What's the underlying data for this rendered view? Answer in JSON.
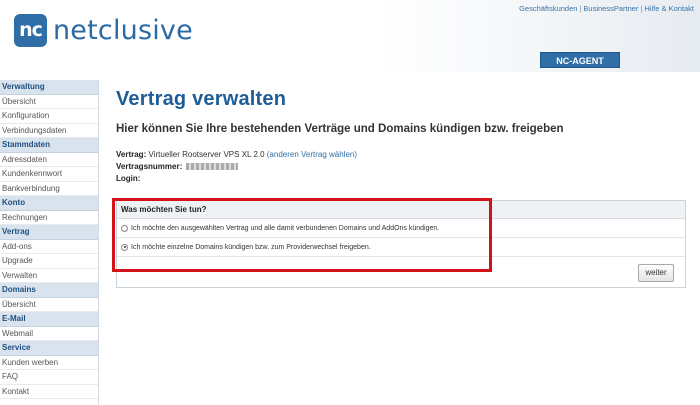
{
  "header": {
    "logo_mark": "nc",
    "logo_text": "netclusive",
    "top_links": [
      "Geschäftskunden",
      "BusinessPartner",
      "Hilfe & Kontakt"
    ],
    "agent_tab": "NC-AGENT"
  },
  "sidebar": [
    {
      "type": "head",
      "label": "Verwaltung"
    },
    {
      "type": "item",
      "label": "Übersicht"
    },
    {
      "type": "item",
      "label": "Konfiguration"
    },
    {
      "type": "item",
      "label": "Verbindungsdaten"
    },
    {
      "type": "head",
      "label": "Stammdaten"
    },
    {
      "type": "item",
      "label": "Adressdaten"
    },
    {
      "type": "item",
      "label": "Kundenkennwort"
    },
    {
      "type": "item",
      "label": "Bankverbindung"
    },
    {
      "type": "head",
      "label": "Konto"
    },
    {
      "type": "item",
      "label": "Rechnungen"
    },
    {
      "type": "head",
      "label": "Vertrag"
    },
    {
      "type": "item",
      "label": "Add-ons"
    },
    {
      "type": "item",
      "label": "Upgrade"
    },
    {
      "type": "item",
      "label": "Verwalten"
    },
    {
      "type": "head",
      "label": "Domains"
    },
    {
      "type": "item",
      "label": "Übersicht"
    },
    {
      "type": "head",
      "label": "E-Mail"
    },
    {
      "type": "item",
      "label": "Webmail"
    },
    {
      "type": "head",
      "label": "Service"
    },
    {
      "type": "item",
      "label": "Kunden werben"
    },
    {
      "type": "item",
      "label": "FAQ"
    },
    {
      "type": "item",
      "label": "Kontakt"
    }
  ],
  "main": {
    "title": "Vertrag verwalten",
    "subtitle": "Hier können Sie Ihre bestehenden Verträge und Domains kündigen bzw. freigeben",
    "contract_label": "Vertrag:",
    "contract_value": "Virtueller Rootserver VPS XL 2.0",
    "contract_link": "(anderen Vertrag wählen)",
    "number_label": "Vertragsnummer:",
    "login_label": "Login:"
  },
  "options": {
    "heading": "Was möchten Sie tun?",
    "items": [
      {
        "label": "Ich möchte den ausgewählten Vertrag und alle damit verbundenen Domains und AddOns kündigen.",
        "checked": false
      },
      {
        "label": "Ich möchte einzelne Domains kündigen bzw. zum Providerwechsel freigeben.",
        "checked": true
      }
    ],
    "submit": "weiter"
  }
}
